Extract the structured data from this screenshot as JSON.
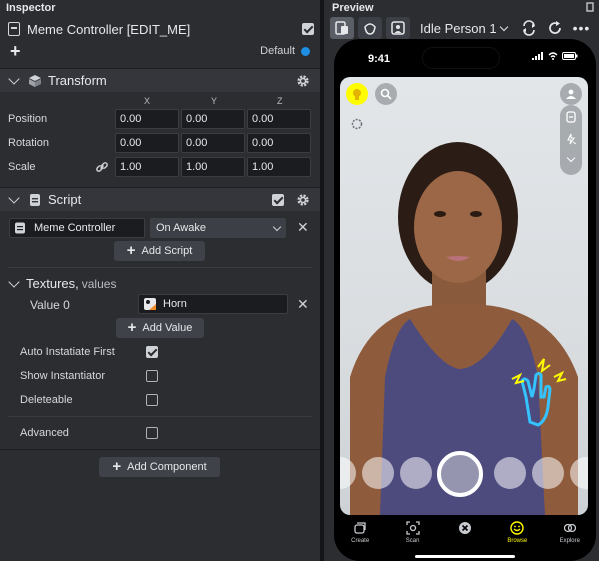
{
  "inspector": {
    "title": "Inspector",
    "object_name": "Meme Controller [EDIT_ME]",
    "object_enabled": true,
    "layer_label": "Default",
    "layer_color": "#1d8fe5",
    "transform": {
      "title": "Transform",
      "axes": [
        "X",
        "Y",
        "Z"
      ],
      "position_label": "Position",
      "position": [
        "0.00",
        "0.00",
        "0.00"
      ],
      "rotation_label": "Rotation",
      "rotation": [
        "0.00",
        "0.00",
        "0.00"
      ],
      "scale_label": "Scale",
      "scale": [
        "1.00",
        "1.00",
        "1.00"
      ]
    },
    "script": {
      "title": "Script",
      "enabled": true,
      "script_name": "Meme Controller",
      "event": "On Awake",
      "add_script_label": "Add Script",
      "textures_label": "Textures,",
      "textures_sub": "values",
      "value_label": "Value 0",
      "value_asset": "Horn",
      "add_value_label": "Add Value",
      "options": [
        {
          "label": "Auto Instatiate First",
          "checked": true
        },
        {
          "label": "Show Instantiator",
          "checked": false
        },
        {
          "label": "Deleteable",
          "checked": false
        }
      ],
      "advanced_label": "Advanced",
      "advanced_checked": false
    },
    "add_component_label": "Add Component"
  },
  "preview": {
    "title": "Preview",
    "person_select": "Idle Person 1",
    "status_time": "9:41",
    "nav": [
      {
        "label": "Create",
        "active": false
      },
      {
        "label": "Scan",
        "active": false
      },
      {
        "label": "",
        "active": false
      },
      {
        "label": "Browse",
        "active": true
      },
      {
        "label": "Explore",
        "active": false
      }
    ],
    "accent_yellow": "#fffc00"
  }
}
